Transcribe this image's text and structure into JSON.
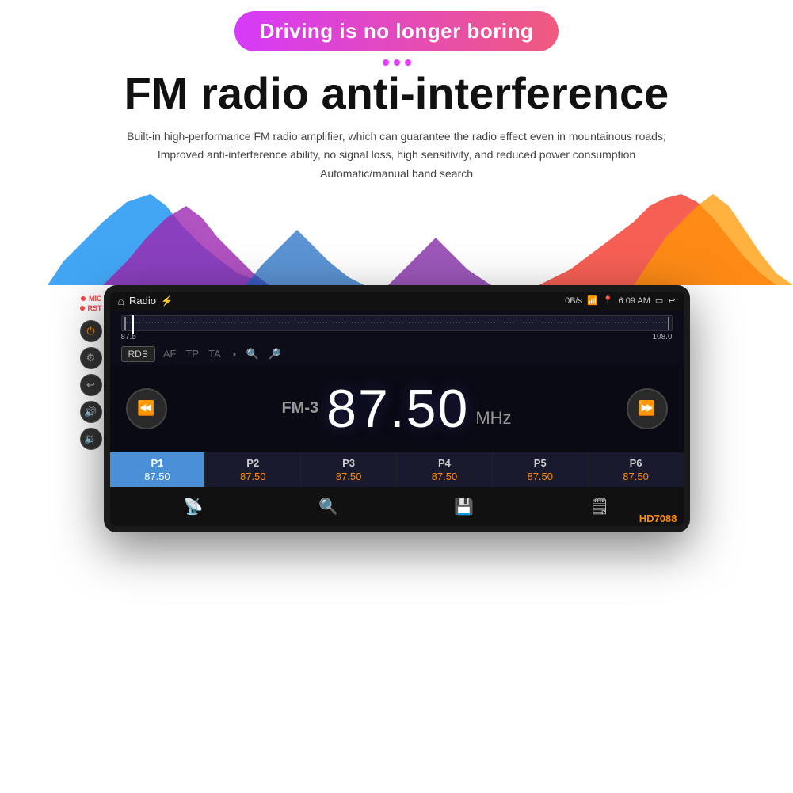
{
  "banner": {
    "text": "Driving is no longer boring"
  },
  "heading": {
    "main": "FM radio anti-interference"
  },
  "description": {
    "line1": "Built-in high-performance FM radio amplifier, which can guarantee the radio effect even in mountainous roads;",
    "line2": "Improved anti-interference ability, no signal loss, high sensitivity, and reduced power consumption",
    "line3": "Automatic/manual band search"
  },
  "status_bar": {
    "title": "Radio",
    "usb": "⚡",
    "speed": "0B/s",
    "wifi": "WiFi",
    "location": "📍",
    "time": "6:09 AM",
    "home_icon": "⌂",
    "back_icon": "↩"
  },
  "freq_scale": {
    "min": "87.5",
    "max": "108.0"
  },
  "rds": {
    "btn_label": "RDS",
    "options": [
      "AF",
      "TP",
      "TA",
      "◑",
      "🔍",
      "🔎"
    ]
  },
  "radio": {
    "band": "FM-3",
    "frequency": "87.50",
    "unit": "MHz",
    "prev_icon": "⏪",
    "next_icon": "⏩"
  },
  "presets": [
    {
      "name": "P1",
      "freq": "87.50",
      "active": true
    },
    {
      "name": "P2",
      "freq": "87.50",
      "active": false
    },
    {
      "name": "P3",
      "freq": "87.50",
      "active": false
    },
    {
      "name": "P4",
      "freq": "87.50",
      "active": false
    },
    {
      "name": "P5",
      "freq": "87.50",
      "active": false
    },
    {
      "name": "P6",
      "freq": "87.50",
      "active": false
    }
  ],
  "toolbar": {
    "icons": [
      "📡",
      "🔍",
      "💾",
      "🗒"
    ]
  },
  "model": "HD7088",
  "side_controls": [
    {
      "label": "MIC",
      "type": "dot-red"
    },
    {
      "label": "RST",
      "type": "dot-red"
    },
    {
      "icon": "⏻",
      "type": "orange-circle"
    },
    {
      "icon": "⚙",
      "type": "circle"
    },
    {
      "icon": "↩",
      "type": "circle"
    },
    {
      "icon": "🔊",
      "type": "orange-circle"
    },
    {
      "icon": "🔉",
      "type": "orange-circle"
    }
  ]
}
